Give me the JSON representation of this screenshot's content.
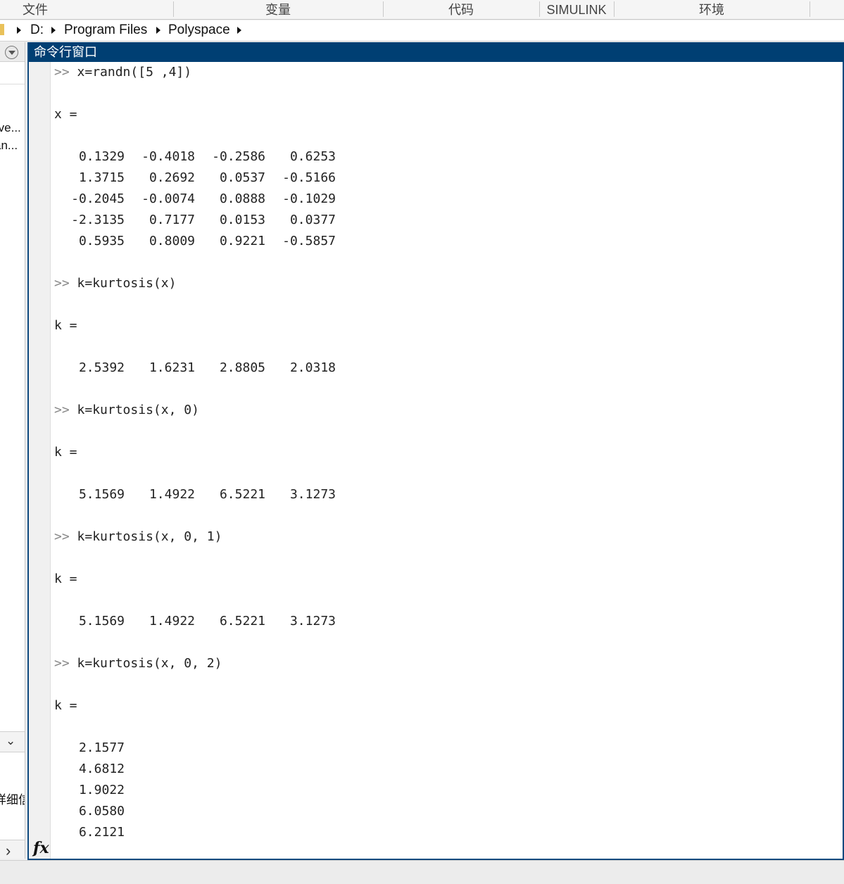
{
  "ribbon": {
    "sections": [
      "文件",
      "变量",
      "代码",
      "SIMULINK",
      "环境"
    ]
  },
  "address": {
    "crumbs": [
      "D:",
      "Program Files",
      "Polyspace"
    ]
  },
  "left_panel": {
    "line1": "rve...",
    "line2": "an...",
    "line3": "详细信",
    "chevron_down": "⌄",
    "chevron_right": "›"
  },
  "command_window": {
    "title": "命令行窗口",
    "fx_label": "fx",
    "prompt": ">>",
    "commands": {
      "c1": "x=randn([5 ,4])",
      "c2": "k=kurtosis(x)",
      "c3": "k=kurtosis(x, 0)",
      "c4": "k=kurtosis(x, 0, 1)",
      "c5": "k=kurtosis(x, 0, 2)"
    },
    "labels": {
      "x_eq": "x =",
      "k_eq": "k ="
    },
    "x_matrix": [
      [
        "0.1329",
        "-0.4018",
        "-0.2586",
        "0.6253"
      ],
      [
        "1.3715",
        "0.2692",
        "0.0537",
        "-0.5166"
      ],
      [
        "-0.2045",
        "-0.0074",
        "0.0888",
        "-0.1029"
      ],
      [
        "-2.3135",
        "0.7177",
        "0.0153",
        "0.0377"
      ],
      [
        "0.5935",
        "0.8009",
        "0.9221",
        "-0.5857"
      ]
    ],
    "k1": [
      "2.5392",
      "1.6231",
      "2.8805",
      "2.0318"
    ],
    "k2": [
      "5.1569",
      "1.4922",
      "6.5221",
      "3.1273"
    ],
    "k3": [
      "5.1569",
      "1.4922",
      "6.5221",
      "3.1273"
    ],
    "k4": [
      "2.1577",
      "4.6812",
      "1.9022",
      "6.0580",
      "6.2121"
    ]
  }
}
